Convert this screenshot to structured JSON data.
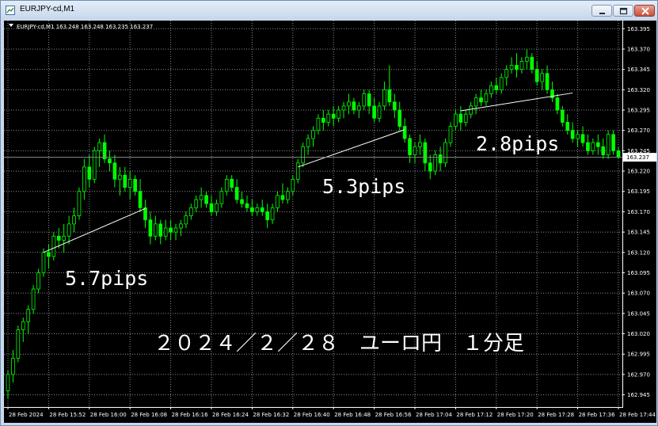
{
  "window": {
    "title": "EURJPY-cd,M1",
    "title_icon": "chart-window-icon",
    "controls": [
      "minimize-icon",
      "maximize-icon",
      "close-icon"
    ]
  },
  "chart_header": "EURJPY-cd,M1  163.248 163.248 163.235 163.237",
  "current_price_label": "163.237",
  "colors": {
    "background": "#000000",
    "grid": "#8c8c8c",
    "candle": "#00ff00",
    "annotation": "#ffffff"
  },
  "annotations": [
    "5.7pips",
    "5.3pips",
    "2.8pips",
    "２０２４／２／２８　ユーロ円　１分足"
  ],
  "chart_data": {
    "type": "candlestick",
    "ylim": [
      162.93,
      163.405
    ],
    "y_ticks": [
      "162.945",
      "162.970",
      "162.995",
      "163.020",
      "163.045",
      "163.070",
      "163.095",
      "163.120",
      "163.145",
      "163.170",
      "163.195",
      "163.220",
      "163.245",
      "163.270",
      "163.295",
      "163.320",
      "163.345",
      "163.370",
      "163.395"
    ],
    "x_ticks": [
      "28 Feb 2024",
      "28 Feb 15:52",
      "28 Feb 16:00",
      "28 Feb 16:08",
      "28 Feb 16:16",
      "28 Feb 16:24",
      "28 Feb 16:32",
      "28 Feb 16:40",
      "28 Feb 16:48",
      "28 Feb 16:56",
      "28 Feb 17:04",
      "28 Feb 17:12",
      "28 Feb 17:20",
      "28 Feb 17:28",
      "28 Feb 17:36",
      "28 Feb 17:44"
    ],
    "candles_per_xtick": 8,
    "last_price": 163.237,
    "trend_lines": [
      {
        "start": [
          7,
          163.12
        ],
        "end": [
          27,
          163.174
        ],
        "label": "5.7pips"
      },
      {
        "start": [
          57,
          163.225
        ],
        "end": [
          78,
          163.271
        ],
        "label": "5.3pips"
      },
      {
        "start": [
          89,
          163.294
        ],
        "end": [
          111,
          163.316
        ],
        "label": "2.8pips"
      }
    ],
    "candles": [
      [
        162.95,
        162.975,
        162.94,
        162.97
      ],
      [
        162.97,
        163.0,
        162.96,
        162.99
      ],
      [
        162.99,
        163.03,
        162.985,
        163.025
      ],
      [
        163.025,
        163.04,
        163.01,
        163.035
      ],
      [
        163.035,
        163.055,
        163.02,
        163.05
      ],
      [
        163.05,
        163.08,
        163.045,
        163.075
      ],
      [
        163.075,
        163.1,
        163.07,
        163.095
      ],
      [
        163.095,
        163.125,
        163.09,
        163.12
      ],
      [
        163.12,
        163.13,
        163.1,
        163.115
      ],
      [
        163.115,
        163.145,
        163.11,
        163.14
      ],
      [
        163.14,
        163.15,
        163.125,
        163.135
      ],
      [
        163.135,
        163.155,
        163.12,
        163.14
      ],
      [
        163.14,
        163.165,
        163.13,
        163.155
      ],
      [
        163.155,
        163.175,
        163.145,
        163.165
      ],
      [
        163.165,
        163.2,
        163.16,
        163.195
      ],
      [
        163.195,
        163.235,
        163.185,
        163.225
      ],
      [
        163.225,
        163.24,
        163.2,
        163.21
      ],
      [
        163.21,
        163.25,
        163.205,
        163.245
      ],
      [
        163.245,
        163.26,
        163.225,
        163.255
      ],
      [
        163.255,
        163.265,
        163.23,
        163.235
      ],
      [
        163.235,
        163.245,
        163.22,
        163.23
      ],
      [
        163.23,
        163.24,
        163.2,
        163.21
      ],
      [
        163.21,
        163.225,
        163.19,
        163.215
      ],
      [
        163.215,
        163.225,
        163.195,
        163.2
      ],
      [
        163.2,
        163.22,
        163.185,
        163.21
      ],
      [
        163.21,
        163.215,
        163.19,
        163.195
      ],
      [
        163.195,
        163.21,
        163.17,
        163.175
      ],
      [
        163.175,
        163.185,
        163.15,
        163.16
      ],
      [
        163.16,
        163.17,
        163.13,
        163.14
      ],
      [
        163.14,
        163.165,
        163.135,
        163.155
      ],
      [
        163.155,
        163.16,
        163.13,
        163.14
      ],
      [
        163.14,
        163.16,
        163.135,
        163.15
      ],
      [
        163.15,
        163.16,
        163.135,
        163.145
      ],
      [
        163.145,
        163.155,
        163.135,
        163.15
      ],
      [
        163.15,
        163.16,
        163.14,
        163.155
      ],
      [
        163.155,
        163.17,
        163.15,
        163.165
      ],
      [
        163.165,
        163.18,
        163.16,
        163.175
      ],
      [
        163.175,
        163.19,
        163.17,
        163.185
      ],
      [
        163.185,
        163.2,
        163.175,
        163.19
      ],
      [
        163.19,
        163.195,
        163.175,
        163.18
      ],
      [
        163.18,
        163.19,
        163.165,
        163.17
      ],
      [
        163.17,
        163.185,
        163.165,
        163.18
      ],
      [
        163.18,
        163.2,
        163.175,
        163.195
      ],
      [
        163.195,
        163.215,
        163.19,
        163.21
      ],
      [
        163.21,
        163.215,
        163.195,
        163.2
      ],
      [
        163.2,
        163.21,
        163.18,
        163.185
      ],
      [
        163.185,
        163.195,
        163.175,
        163.18
      ],
      [
        163.18,
        163.19,
        163.17,
        163.175
      ],
      [
        163.175,
        163.185,
        163.165,
        163.17
      ],
      [
        163.17,
        163.18,
        163.165,
        163.175
      ],
      [
        163.175,
        163.185,
        163.165,
        163.17
      ],
      [
        163.17,
        163.18,
        163.15,
        163.16
      ],
      [
        163.16,
        163.18,
        163.155,
        163.175
      ],
      [
        163.175,
        163.195,
        163.17,
        163.19
      ],
      [
        163.19,
        163.205,
        163.18,
        163.185
      ],
      [
        163.185,
        163.2,
        163.18,
        163.195
      ],
      [
        163.195,
        163.215,
        163.19,
        163.21
      ],
      [
        163.21,
        163.235,
        163.205,
        163.23
      ],
      [
        163.23,
        163.255,
        163.225,
        163.25
      ],
      [
        163.25,
        163.265,
        163.24,
        163.26
      ],
      [
        163.26,
        163.275,
        163.25,
        163.27
      ],
      [
        163.27,
        163.29,
        163.265,
        163.285
      ],
      [
        163.285,
        163.295,
        163.27,
        163.28
      ],
      [
        163.28,
        163.295,
        163.275,
        163.29
      ],
      [
        163.29,
        163.3,
        163.275,
        163.285
      ],
      [
        163.285,
        163.3,
        163.28,
        163.295
      ],
      [
        163.295,
        163.305,
        163.285,
        163.3
      ],
      [
        163.3,
        163.315,
        163.29,
        163.305
      ],
      [
        163.305,
        163.31,
        163.29,
        163.295
      ],
      [
        163.295,
        163.305,
        163.285,
        163.3
      ],
      [
        163.3,
        163.32,
        163.295,
        163.315
      ],
      [
        163.315,
        163.32,
        163.29,
        163.3
      ],
      [
        163.3,
        163.31,
        163.28,
        163.285
      ],
      [
        163.285,
        163.305,
        163.28,
        163.3
      ],
      [
        163.3,
        163.33,
        163.295,
        163.32
      ],
      [
        163.32,
        163.35,
        163.3,
        163.305
      ],
      [
        163.305,
        163.315,
        163.285,
        163.295
      ],
      [
        163.295,
        163.305,
        163.27,
        163.275
      ],
      [
        163.275,
        163.285,
        163.255,
        163.26
      ],
      [
        163.26,
        163.265,
        163.23,
        163.24
      ],
      [
        163.24,
        163.255,
        163.23,
        163.25
      ],
      [
        163.25,
        163.265,
        163.24,
        163.255
      ],
      [
        163.255,
        163.26,
        163.22,
        163.23
      ],
      [
        163.23,
        163.24,
        163.21,
        163.22
      ],
      [
        163.22,
        163.245,
        163.215,
        163.24
      ],
      [
        163.24,
        163.25,
        163.22,
        163.23
      ],
      [
        163.23,
        163.26,
        163.225,
        163.255
      ],
      [
        163.255,
        163.28,
        163.25,
        163.275
      ],
      [
        163.275,
        163.295,
        163.27,
        163.29
      ],
      [
        163.29,
        163.3,
        163.27,
        163.28
      ],
      [
        163.28,
        163.295,
        163.275,
        163.29
      ],
      [
        163.29,
        163.305,
        163.285,
        163.3
      ],
      [
        163.3,
        163.315,
        163.29,
        163.31
      ],
      [
        163.31,
        163.32,
        163.3,
        163.305
      ],
      [
        163.305,
        163.32,
        163.3,
        163.315
      ],
      [
        163.315,
        163.33,
        163.31,
        163.325
      ],
      [
        163.325,
        163.335,
        163.315,
        163.32
      ],
      [
        163.32,
        163.34,
        163.315,
        163.335
      ],
      [
        163.335,
        163.35,
        163.325,
        163.345
      ],
      [
        163.345,
        163.36,
        163.34,
        163.35
      ],
      [
        163.35,
        163.365,
        163.335,
        163.345
      ],
      [
        163.345,
        163.36,
        163.34,
        163.355
      ],
      [
        163.355,
        163.37,
        163.345,
        163.36
      ],
      [
        163.36,
        163.365,
        163.34,
        163.345
      ],
      [
        163.345,
        163.355,
        163.325,
        163.33
      ],
      [
        163.33,
        163.345,
        163.32,
        163.34
      ],
      [
        163.34,
        163.35,
        163.315,
        163.32
      ],
      [
        163.32,
        163.33,
        163.305,
        163.31
      ],
      [
        163.31,
        163.315,
        163.29,
        163.295
      ],
      [
        163.295,
        163.3,
        163.275,
        163.28
      ],
      [
        163.28,
        163.29,
        163.265,
        163.27
      ],
      [
        163.27,
        163.28,
        163.255,
        163.26
      ],
      [
        163.26,
        163.27,
        163.25,
        163.265
      ],
      [
        163.265,
        163.275,
        163.25,
        163.255
      ],
      [
        163.255,
        163.265,
        163.24,
        163.245
      ],
      [
        163.245,
        163.26,
        163.24,
        163.255
      ],
      [
        163.255,
        163.265,
        163.24,
        163.25
      ],
      [
        163.25,
        163.26,
        163.235,
        163.24
      ],
      [
        163.24,
        163.27,
        163.235,
        163.265
      ],
      [
        163.265,
        163.27,
        163.24,
        163.245
      ],
      [
        163.245,
        163.25,
        163.235,
        163.237
      ]
    ]
  }
}
